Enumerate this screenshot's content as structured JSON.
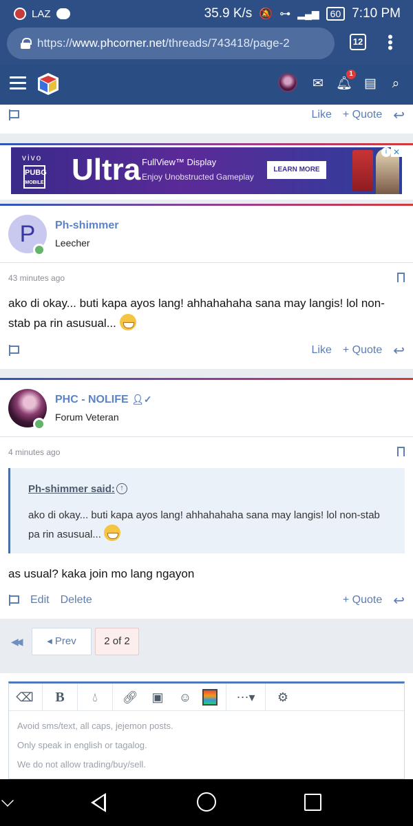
{
  "status_bar": {
    "carrier": "LAZ",
    "network_speed": "35.9 K/s",
    "network_type": "4G",
    "battery": "60",
    "time": "7:10 PM"
  },
  "browser": {
    "url_scheme": "https://",
    "url_host": "www.phcorner.net",
    "url_path": "/threads/743418/page-2",
    "tab_count": "12"
  },
  "site_nav": {
    "notification_count": "1"
  },
  "top_actions": {
    "like": "Like",
    "quote": "Quote"
  },
  "ad": {
    "brand": "vivo",
    "game_line1": "PUBG",
    "game_line2": "MOBILE",
    "headline": "Ultra",
    "line1": "FullView™ Display",
    "line2": "Enjoy Unobstructed Gameplay",
    "cta": "LEARN MORE"
  },
  "posts": [
    {
      "avatar_letter": "P",
      "username": "Ph-shimmer",
      "user_title": "Leecher",
      "time": "43 minutes ago",
      "body": "ako di okay... buti kapa ayos lang! ahhahahaha sana may langis! lol non-stab pa rin asusual...",
      "like": "Like",
      "quote": "Quote"
    },
    {
      "username": "PHC - NOLIFE",
      "user_title": "Forum Veteran",
      "time": "4 minutes ago",
      "quote_author": "Ph-shimmer said:",
      "quote_text": "ako di okay... buti kapa ayos lang! ahhahahaha sana may langis! lol non-stab pa rin asusual...",
      "body": "as usual? kaka join mo lang ngayon",
      "edit": "Edit",
      "delete": "Delete",
      "quote": "Quote"
    }
  ],
  "pagination": {
    "prev": "Prev",
    "current": "2 of 2"
  },
  "editor": {
    "placeholder_lines": [
      "Avoid sms/text, all caps, jejemon posts.",
      "Only speak in english or tagalog.",
      "We do not allow trading/buy/sell."
    ]
  }
}
